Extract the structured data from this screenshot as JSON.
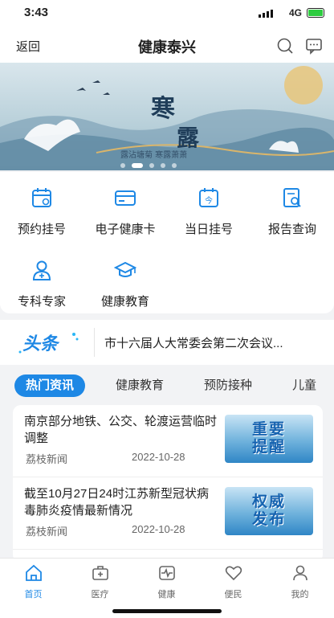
{
  "status": {
    "time": "3:43",
    "network": "4G"
  },
  "nav": {
    "back": "返回",
    "title": "健康泰兴"
  },
  "banner": {
    "title_line1": "寒",
    "title_line2": "露",
    "caption": "露沾塘菊 寒露萧萧"
  },
  "quick_menu": [
    {
      "label": "预约挂号",
      "icon": "calendar-icon"
    },
    {
      "label": "电子健康卡",
      "icon": "card-icon"
    },
    {
      "label": "当日挂号",
      "icon": "today-calendar-icon"
    },
    {
      "label": "报告查询",
      "icon": "report-search-icon"
    },
    {
      "label": "专科专家",
      "icon": "doctor-icon"
    },
    {
      "label": "健康教育",
      "icon": "graduation-cap-icon"
    }
  ],
  "headline": {
    "logo": "头条",
    "text": "市十六届人大常委会第二次会议..."
  },
  "tabs": [
    "热门资讯",
    "健康教育",
    "预防接种",
    "儿童"
  ],
  "news": [
    {
      "title": "南京部分地铁、公交、轮渡运营临时调整",
      "source": "荔枝新闻",
      "date": "2022-10-28",
      "thumb_l1": "重要",
      "thumb_l2": "提醒"
    },
    {
      "title": "截至10月27日24时江苏新型冠状病毒肺炎疫情最新情况",
      "source": "荔枝新闻",
      "date": "2022-10-28",
      "thumb_l1": "权威",
      "thumb_l2": "发布"
    }
  ],
  "tabbar": [
    {
      "label": "首页",
      "icon": "home-icon",
      "active": true
    },
    {
      "label": "医疗",
      "icon": "medical-kit-icon"
    },
    {
      "label": "健康",
      "icon": "heartbeat-icon"
    },
    {
      "label": "便民",
      "icon": "heart-hand-icon"
    },
    {
      "label": "我的",
      "icon": "user-icon"
    }
  ],
  "colors": {
    "accent": "#1e88e5",
    "battery": "#2ecc40"
  }
}
